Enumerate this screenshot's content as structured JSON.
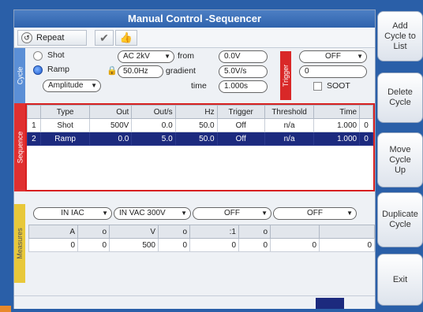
{
  "window": {
    "title": "Manual Control -Sequencer"
  },
  "toolbar": {
    "repeat_label": "Repeat"
  },
  "cycle": {
    "tab_label": "Cycle",
    "shot_label": "Shot",
    "ramp_label": "Ramp",
    "selected_mode": "Ramp",
    "range_select": "AC 2kV",
    "frequency": "50.0Hz",
    "param_select": "Amplitude",
    "from_label": "from",
    "from_value": "0.0V",
    "gradient_label": "gradient",
    "gradient_value": "5.0V/s",
    "time_label": "time",
    "time_value": "1.000s"
  },
  "trigger": {
    "tab_label": "Trigger",
    "select": "OFF",
    "value": "0",
    "soot_label": "SOOT",
    "soot_checked": false
  },
  "sequence": {
    "tab_label": "Sequence",
    "columns": [
      "",
      "Type",
      "Out",
      "Out/s",
      "Hz",
      "Trigger",
      "Threshold",
      "Time",
      ""
    ],
    "rows": [
      {
        "num": "1",
        "type": "Shot",
        "out": "500V",
        "outs": "0.0",
        "hz": "50.0",
        "trigger": "Off",
        "threshold": "n/a",
        "time": "1.000",
        "extra": "0",
        "selected": false
      },
      {
        "num": "2",
        "type": "Ramp",
        "out": "0.0",
        "outs": "5.0",
        "hz": "50.0",
        "trigger": "Off",
        "threshold": "n/a",
        "time": "1.000",
        "extra": "0",
        "selected": true
      }
    ]
  },
  "measures": {
    "tab_label": "Measures",
    "selects": [
      "IN IAC",
      "IN VAC 300V",
      "OFF",
      "OFF"
    ],
    "columns": [
      "A",
      "o",
      "V",
      "o",
      ":1",
      "o",
      "",
      ""
    ],
    "values": [
      "0",
      "0",
      "500",
      "0",
      "0",
      "0",
      "0",
      "0"
    ]
  },
  "side_buttons": {
    "add": "Add Cycle to List",
    "delete": "Delete Cycle",
    "move_up": "Move Cycle Up",
    "duplicate": "Duplicate Cycle",
    "exit": "Exit"
  }
}
